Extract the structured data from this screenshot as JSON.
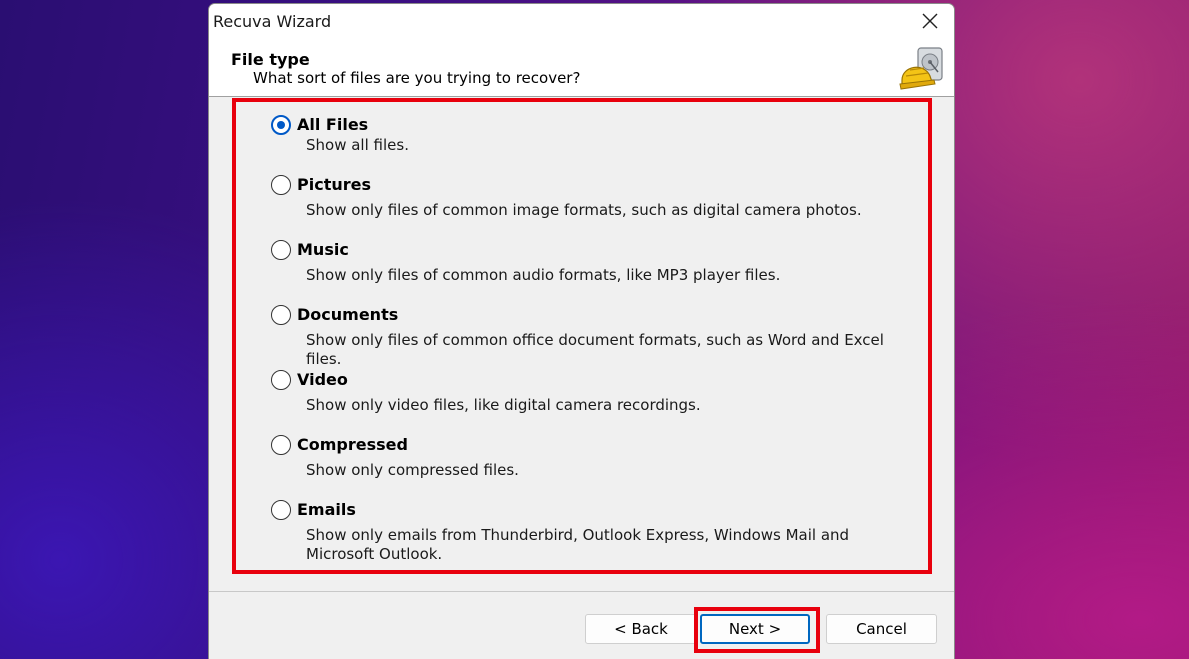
{
  "window": {
    "title": "Recuva Wizard"
  },
  "header": {
    "title": "File type",
    "subtitle": "What sort of files are you trying to recover?",
    "logo_icon": "recuva-hardhat-drive-icon"
  },
  "options": [
    {
      "label": "All Files",
      "description": "Show all files.",
      "checked": true
    },
    {
      "label": "Pictures",
      "description": "Show only files of common image formats, such as digital camera photos.",
      "checked": false
    },
    {
      "label": "Music",
      "description": "Show only files of common audio formats, like MP3 player files.",
      "checked": false
    },
    {
      "label": "Documents",
      "description": "Show only files of common office document formats, such as Word and Excel files.",
      "checked": false
    },
    {
      "label": "Video",
      "description": "Show only video files, like digital camera recordings.",
      "checked": false
    },
    {
      "label": "Compressed",
      "description": "Show only compressed files.",
      "checked": false
    },
    {
      "label": "Emails",
      "description": "Show only emails from Thunderbird, Outlook Express, Windows Mail and Microsoft Outlook.",
      "checked": false
    }
  ],
  "buttons": {
    "back": "< Back",
    "next": "Next >",
    "cancel": "Cancel"
  },
  "colors": {
    "highlight": "#e8000d",
    "radio_accent": "#0059c7",
    "default_button_border": "#0067c0"
  }
}
